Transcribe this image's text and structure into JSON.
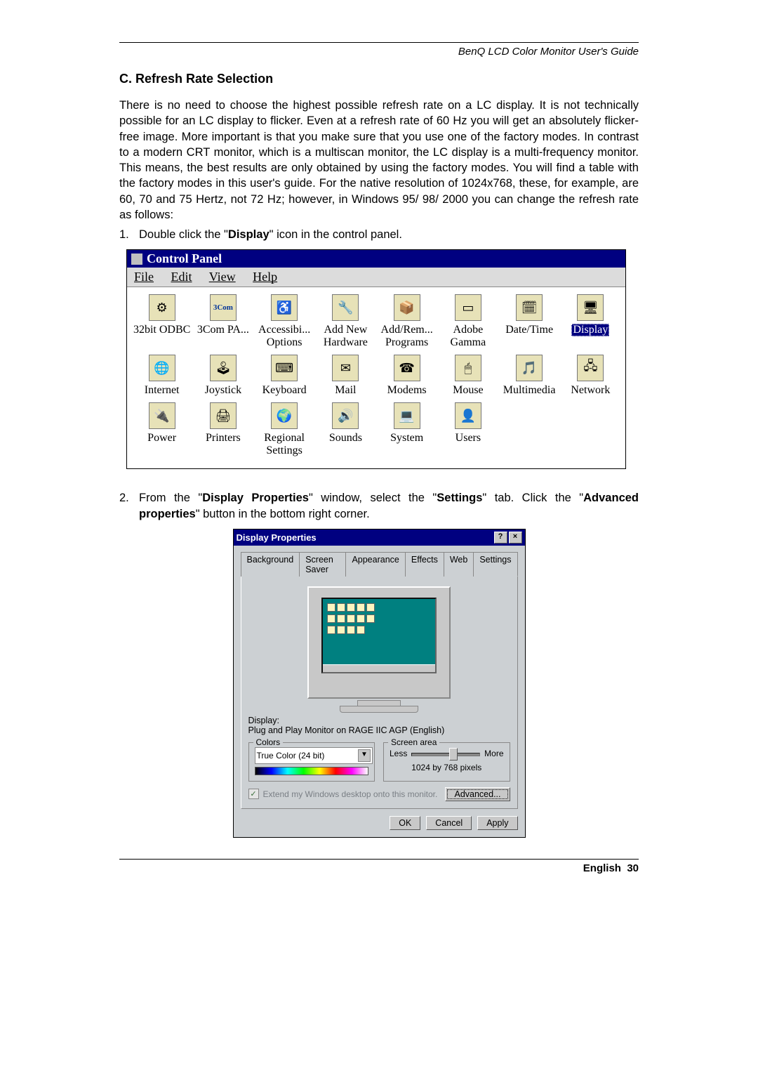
{
  "header": {
    "doc_title": "BenQ LCD Color Monitor User's Guide"
  },
  "section": {
    "heading": "C. Refresh Rate Selection",
    "intro": "There is no need to choose the highest possible refresh rate on a LC display. It is not technically possible for an LC display to flicker. Even at a refresh rate of 60 Hz you will get an absolutely flicker-free image. More important is that you make sure that you use one of the factory modes. In contrast to a modern CRT monitor, which is a multiscan monitor, the LC display is a multi-frequency monitor. This means, the best results are only obtained by using the factory modes. You will find a table with the factory modes in this user's guide. For the native resolution of 1024x768, these, for example, are 60, 70 and 75 Hertz, not 72 Hz; however, in Windows 95/ 98/ 2000 you can change the refresh rate as follows:",
    "step1_num": "1.",
    "step1_pre": "Double click the \"",
    "step1_bold": "Display",
    "step1_post": "\" icon in the control panel.",
    "step2_num": "2.",
    "step2_pre": "From the \"",
    "step2_b1": "Display Properties",
    "step2_mid1": "\" window, select the \"",
    "step2_b2": "Settings",
    "step2_mid2": "\" tab. Click the \"",
    "step2_b3": "Advanced properties",
    "step2_post": "\" button in the bottom right corner."
  },
  "control_panel": {
    "title": "Control Panel",
    "menu": {
      "file": "File",
      "edit": "Edit",
      "view": "View",
      "help": "Help"
    },
    "items": [
      {
        "label": "32bit ODBC",
        "glyph": "⚙"
      },
      {
        "label": "3Com PA...",
        "glyph": "3Com"
      },
      {
        "label": "Accessibi... Options",
        "glyph": "♿"
      },
      {
        "label": "Add New Hardware",
        "glyph": "🔧"
      },
      {
        "label": "Add/Rem... Programs",
        "glyph": "📦"
      },
      {
        "label": "Adobe Gamma",
        "glyph": "▭"
      },
      {
        "label": "Date/Time",
        "glyph": "🗓"
      },
      {
        "label": "Display",
        "glyph": "🖥",
        "selected": true
      },
      {
        "label": "Internet",
        "glyph": "🌐"
      },
      {
        "label": "Joystick",
        "glyph": "🕹"
      },
      {
        "label": "Keyboard",
        "glyph": "⌨"
      },
      {
        "label": "Mail",
        "glyph": "✉"
      },
      {
        "label": "Modems",
        "glyph": "☎"
      },
      {
        "label": "Mouse",
        "glyph": "🖱"
      },
      {
        "label": "Multimedia",
        "glyph": "🎵"
      },
      {
        "label": "Network",
        "glyph": "🖧"
      },
      {
        "label": "Power",
        "glyph": "🔌"
      },
      {
        "label": "Printers",
        "glyph": "🖨"
      },
      {
        "label": "Regional Settings",
        "glyph": "🌍"
      },
      {
        "label": "Sounds",
        "glyph": "🔊"
      },
      {
        "label": "System",
        "glyph": "💻"
      },
      {
        "label": "Users",
        "glyph": "👤"
      }
    ]
  },
  "display_props": {
    "title": "Display Properties",
    "help_btn": "?",
    "close_btn": "×",
    "tabs": [
      "Background",
      "Screen Saver",
      "Appearance",
      "Effects",
      "Web",
      "Settings"
    ],
    "active_tab": "Settings",
    "display_label": "Display:",
    "display_value": "Plug and Play Monitor on RAGE IIC AGP (English)",
    "colors_title": "Colors",
    "colors_value": "True Color (24 bit)",
    "screen_area_title": "Screen area",
    "less": "Less",
    "more": "More",
    "resolution": "1024 by 768 pixels",
    "extend_label": "Extend my Windows desktop onto this monitor.",
    "advanced": "Advanced...",
    "ok": "OK",
    "cancel": "Cancel",
    "apply": "Apply"
  },
  "footer": {
    "lang": "English",
    "page": "30"
  }
}
